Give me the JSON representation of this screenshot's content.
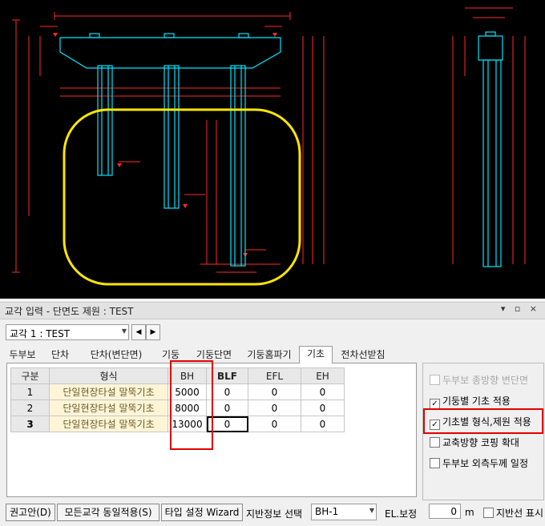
{
  "window": {
    "title": "교각 입력 - 단면도 제원 : TEST",
    "controls": "▾ ▫ ×"
  },
  "selector": {
    "pier": "교각 1 : TEST",
    "prev": "◀",
    "next": "▶"
  },
  "tabs": [
    {
      "label": "두부보"
    },
    {
      "label": "단차"
    },
    {
      "label": "단차(변단면)"
    },
    {
      "label": "기둥"
    },
    {
      "label": "기둥단면"
    },
    {
      "label": "기둥홈파기"
    },
    {
      "label": "기초"
    },
    {
      "label": "전차선받침"
    }
  ],
  "active_tab": "기초",
  "grid": {
    "headers": [
      "구분",
      "형식",
      "BH",
      "BLF",
      "EFL",
      "EH"
    ],
    "rows": [
      {
        "no": "1",
        "type": "단일현장타설 말뚝기초",
        "bh": "5000",
        "blf": "0",
        "efl": "0",
        "eh": "0"
      },
      {
        "no": "2",
        "type": "단일현장타설 말뚝기초",
        "bh": "8000",
        "blf": "0",
        "efl": "0",
        "eh": "0"
      },
      {
        "no": "3",
        "type": "단일현장타설 말뚝기초",
        "bh": "13000",
        "blf": "0",
        "efl": "0",
        "eh": "0"
      }
    ]
  },
  "options": [
    {
      "label": "두부보 종방향 변단면",
      "checked": false,
      "enabled": false
    },
    {
      "label": "기둥별 기초 적용",
      "checked": true,
      "enabled": true
    },
    {
      "label": "기초별 형식,제원 적용",
      "checked": true,
      "enabled": true
    },
    {
      "label": "교축방향 코핑 확대",
      "checked": false,
      "enabled": true
    },
    {
      "label": "두부보 외측두께 일정",
      "checked": false,
      "enabled": true
    }
  ],
  "bottom": {
    "recommend_button": "권고안(D)",
    "apply_all_button": "모든교각 동일적용(S)",
    "type_wizard_button": "타입 설정 Wizard",
    "ground_label": "지반정보 선택",
    "ground_value": "BH-1",
    "el_label": "EL.보정",
    "el_value": "0",
    "el_unit": "m",
    "ground_line_label": "지반선 표시"
  },
  "colors": {
    "cad_background": "#000000",
    "cad_structure": "#00e5ff",
    "cad_dimension": "#ff2a2a",
    "highlight_ellipse": "#ffe600",
    "highlight_box": "#e00000",
    "type_cell": "#fff5d6"
  }
}
